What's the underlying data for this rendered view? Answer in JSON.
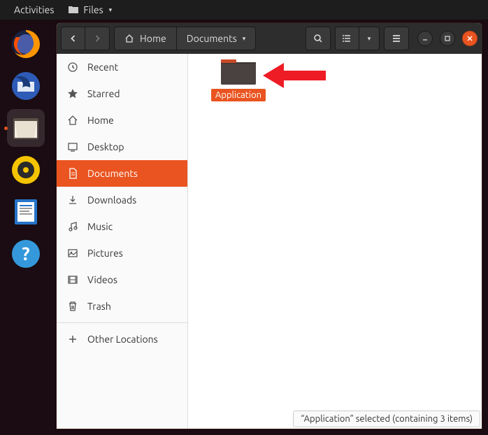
{
  "topbar": {
    "activities": "Activities",
    "files": "Files"
  },
  "dock": {
    "items": [
      "firefox",
      "thunderbird",
      "files",
      "rhythmbox",
      "writer",
      "help"
    ]
  },
  "headerbar": {
    "path": {
      "home": "Home",
      "documents": "Documents"
    }
  },
  "sidebar": {
    "items": [
      {
        "icon": "clock",
        "label": "Recent"
      },
      {
        "icon": "star",
        "label": "Starred"
      },
      {
        "icon": "home",
        "label": "Home"
      },
      {
        "icon": "desktop",
        "label": "Desktop"
      },
      {
        "icon": "document",
        "label": "Documents"
      },
      {
        "icon": "download",
        "label": "Downloads"
      },
      {
        "icon": "music",
        "label": "Music"
      },
      {
        "icon": "picture",
        "label": "Pictures"
      },
      {
        "icon": "video",
        "label": "Videos"
      },
      {
        "icon": "trash",
        "label": "Trash"
      }
    ],
    "other": "Other Locations"
  },
  "main": {
    "folder": {
      "name": "Application"
    }
  },
  "status": "“Application” selected  (containing 3 items)"
}
